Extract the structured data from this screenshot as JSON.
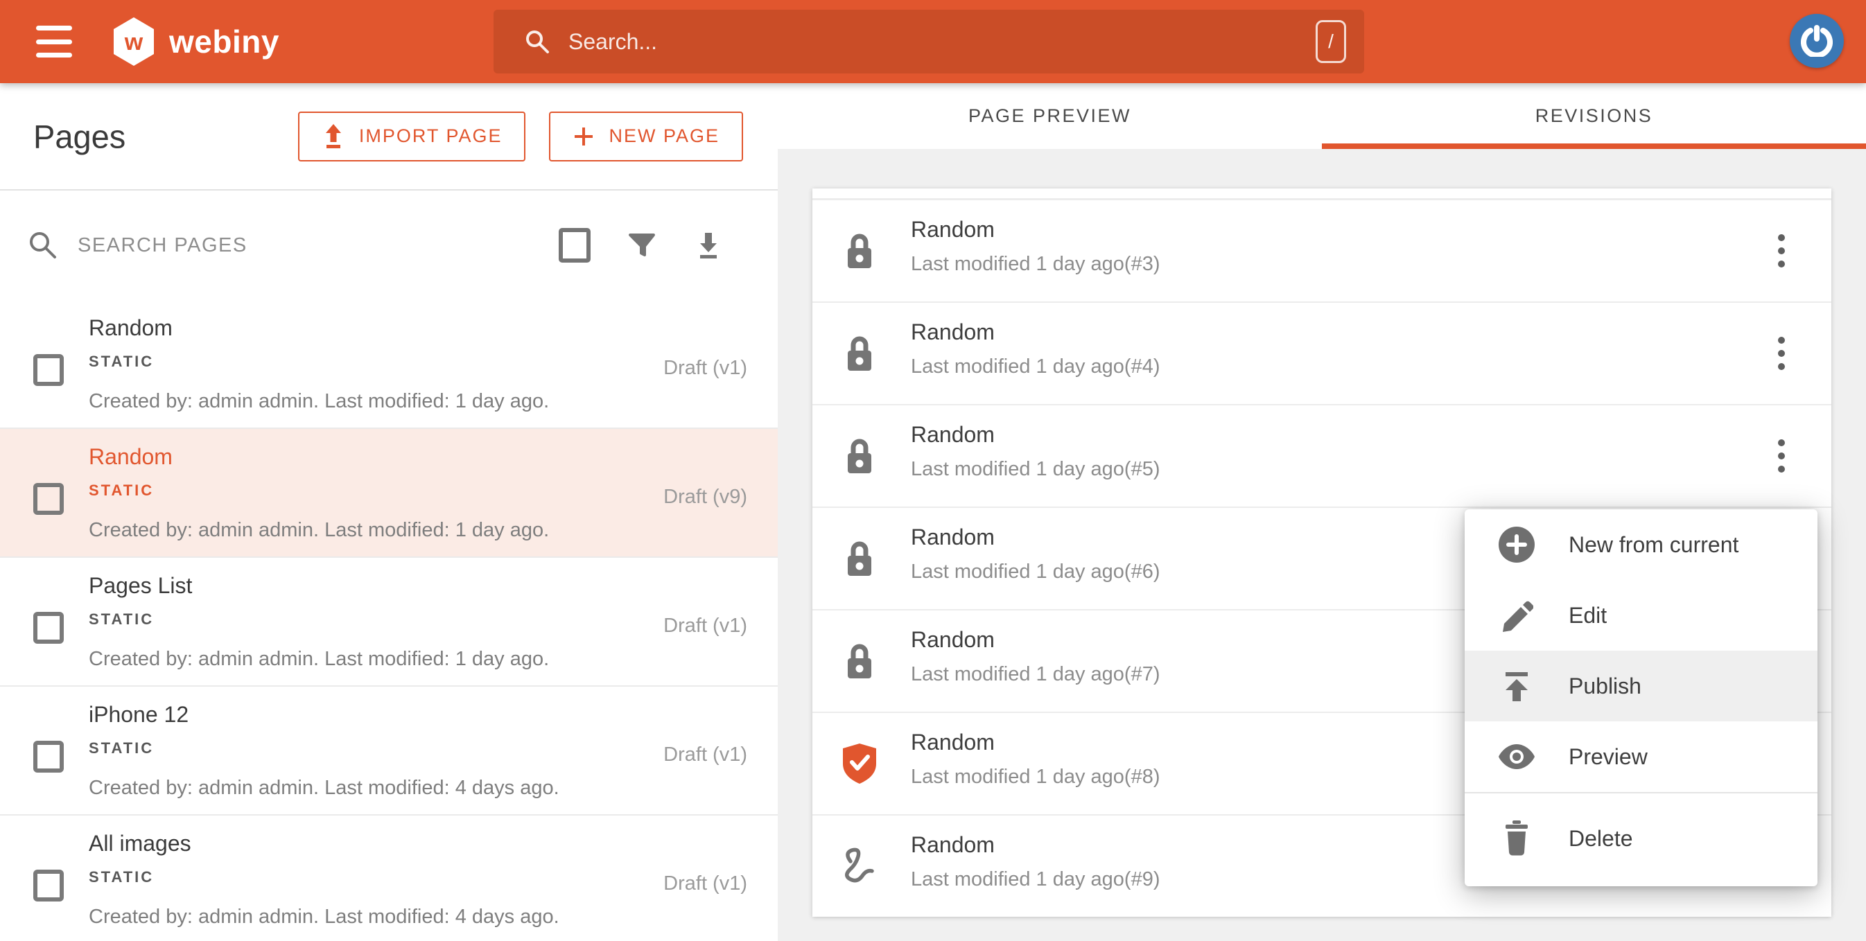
{
  "colors": {
    "accent": "#e1562e",
    "appbar_bg": "#e1562e",
    "appbar_search_bg": "#ca4d27",
    "selected_row_bg": "#fbebe5",
    "panel_gray_bg": "#f0f0f0",
    "avatar_bg": "#3b78b5"
  },
  "app_bar": {
    "menu_icon": "hamburger-icon",
    "brand": "webiny",
    "brand_initial": "w",
    "search": {
      "icon": "search-icon",
      "placeholder": "Search...",
      "shortcut_key": "/"
    },
    "avatar_icon": "power-icon"
  },
  "pages_panel": {
    "title": "Pages",
    "import_button": {
      "icon": "upload-icon",
      "label": "IMPORT PAGE"
    },
    "new_button": {
      "icon": "plus-icon",
      "label": "NEW PAGE"
    },
    "search": {
      "icon": "search-icon",
      "placeholder": "SEARCH PAGES"
    },
    "toolbar_icons": [
      "select-all-icon",
      "filter-icon",
      "download-icon"
    ],
    "pages": [
      {
        "title": "Random",
        "type_label": "STATIC",
        "status": "Draft (v1)",
        "meta": "Created by: admin admin. Last modified: 1 day ago.",
        "selected": false
      },
      {
        "title": "Random",
        "type_label": "STATIC",
        "status": "Draft (v9)",
        "meta": "Created by: admin admin. Last modified: 1 day ago.",
        "selected": true
      },
      {
        "title": "Pages List",
        "type_label": "STATIC",
        "status": "Draft (v1)",
        "meta": "Created by: admin admin. Last modified: 1 day ago.",
        "selected": false
      },
      {
        "title": "iPhone 12",
        "type_label": "STATIC",
        "status": "Draft (v1)",
        "meta": "Created by: admin admin. Last modified: 4 days ago.",
        "selected": false
      },
      {
        "title": "All images",
        "type_label": "STATIC",
        "status": "Draft (v1)",
        "meta": "Created by: admin admin. Last modified: 4 days ago.",
        "selected": false
      }
    ]
  },
  "revisions_panel": {
    "tabs": [
      {
        "label": "PAGE PREVIEW",
        "active": false
      },
      {
        "label": "REVISIONS",
        "active": true
      }
    ],
    "revisions": [
      {
        "title": "Random",
        "meta": "Last modified 1 day ago(#3)",
        "icon": "lock-icon",
        "menu_icon": "kebab-icon"
      },
      {
        "title": "Random",
        "meta": "Last modified 1 day ago(#4)",
        "icon": "lock-icon",
        "menu_icon": "kebab-icon"
      },
      {
        "title": "Random",
        "meta": "Last modified 1 day ago(#5)",
        "icon": "lock-icon",
        "menu_icon": "kebab-icon"
      },
      {
        "title": "Random",
        "meta": "Last modified 1 day ago(#6)",
        "icon": "lock-icon",
        "menu_icon": "kebab-icon"
      },
      {
        "title": "Random",
        "meta": "Last modified 1 day ago(#7)",
        "icon": "lock-icon",
        "menu_icon": "kebab-icon"
      },
      {
        "title": "Random",
        "meta": "Last modified 1 day ago(#8)",
        "icon": "shield-check-icon",
        "menu_icon": "kebab-icon"
      },
      {
        "title": "Random",
        "meta": "Last modified 1 day ago(#9)",
        "icon": "gesture-icon",
        "menu_icon": "kebab-icon"
      }
    ]
  },
  "context_menu": {
    "items": [
      {
        "icon": "plus-circle-icon",
        "label": "New from current",
        "highlighted": false,
        "divider_before": false
      },
      {
        "icon": "pencil-icon",
        "label": "Edit",
        "highlighted": false,
        "divider_before": false
      },
      {
        "icon": "publish-icon",
        "label": "Publish",
        "highlighted": true,
        "divider_before": false
      },
      {
        "icon": "eye-icon",
        "label": "Preview",
        "highlighted": false,
        "divider_before": false
      },
      {
        "icon": "trash-icon",
        "label": "Delete",
        "highlighted": false,
        "divider_before": true
      }
    ]
  }
}
